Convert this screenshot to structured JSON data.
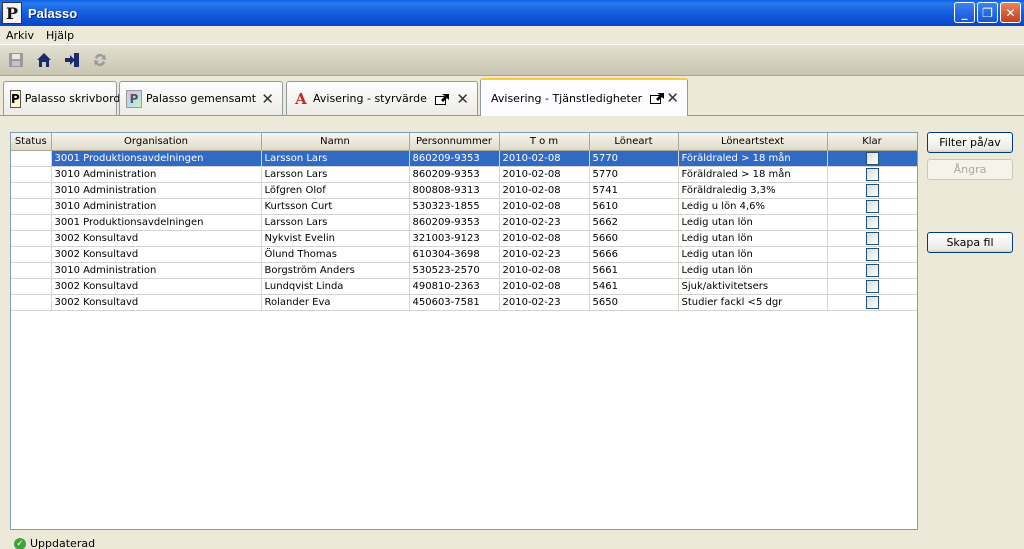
{
  "window": {
    "title": "Palasso",
    "logo_letter": "P"
  },
  "menu": [
    "Arkiv",
    "Hjälp"
  ],
  "toolbar": {
    "icons": [
      "save-icon",
      "home-icon",
      "exit-icon",
      "refresh-icon"
    ]
  },
  "tabs": [
    {
      "label": "Palasso skrivbord",
      "icon": "palasso-icon",
      "closable": false,
      "active": false
    },
    {
      "label": "Palasso gemensamt",
      "icon": "palasso-shared-icon",
      "closable": true,
      "active": false
    },
    {
      "label": "Avisering - styrvärde",
      "icon": "avisering-icon",
      "closable": true,
      "detachable": true,
      "active": false
    },
    {
      "label": "Avisering - Tjänstledigheter",
      "closable": true,
      "detachable": true,
      "active": true
    }
  ],
  "grid": {
    "columns": [
      "Status",
      "Organisation",
      "Namn",
      "Personnummer",
      "T o m",
      "Löneart",
      "Löneartstext",
      "Klar"
    ],
    "rows": [
      [
        "",
        "3001 Produktionsavdelningen",
        "Larsson Lars",
        "860209-9353",
        "2010-02-08",
        "5770",
        "Föräldraled > 18 mån"
      ],
      [
        "",
        "3010 Administration",
        "Larsson Lars",
        "860209-9353",
        "2010-02-08",
        "5770",
        "Föräldraled > 18 mån"
      ],
      [
        "",
        "3010 Administration",
        "Löfgren Olof",
        "800808-9313",
        "2010-02-08",
        "5741",
        "Föräldraledig 3,3%"
      ],
      [
        "",
        "3010 Administration",
        "Kurtsson Curt",
        "530323-1855",
        "2010-02-08",
        "5610",
        "Ledig u lön 4,6%"
      ],
      [
        "",
        "3001 Produktionsavdelningen",
        "Larsson Lars",
        "860209-9353",
        "2010-02-23",
        "5662",
        "Ledig utan lön"
      ],
      [
        "",
        "3002 Konsultavd",
        "Nykvist Evelin",
        "321003-9123",
        "2010-02-08",
        "5660",
        "Ledig utan lön"
      ],
      [
        "",
        "3002 Konsultavd",
        "Ölund Thomas",
        "610304-3698",
        "2010-02-23",
        "5666",
        "Ledig utan lön"
      ],
      [
        "",
        "3010 Administration",
        "Borgström Anders",
        "530523-2570",
        "2010-02-08",
        "5661",
        "Ledig utan lön"
      ],
      [
        "",
        "3002 Konsultavd",
        "Lundqvist Linda",
        "490810-2363",
        "2010-02-08",
        "5461",
        "Sjuk/aktivitetsers"
      ],
      [
        "",
        "3002 Konsultavd",
        "Rolander Eva",
        "450603-7581",
        "2010-02-23",
        "5650",
        "Studier fackl <5 dgr"
      ]
    ],
    "selected_row": 0
  },
  "buttons": {
    "filter": "Filter på/av",
    "undo": "Ångra",
    "create_file": "Skapa fil"
  },
  "status": {
    "text": "Uppdaterad"
  },
  "colors": {
    "selection": "#316ac5",
    "titlebar": "#0a5fe3",
    "active_tab_accent": "#ffc83c"
  }
}
